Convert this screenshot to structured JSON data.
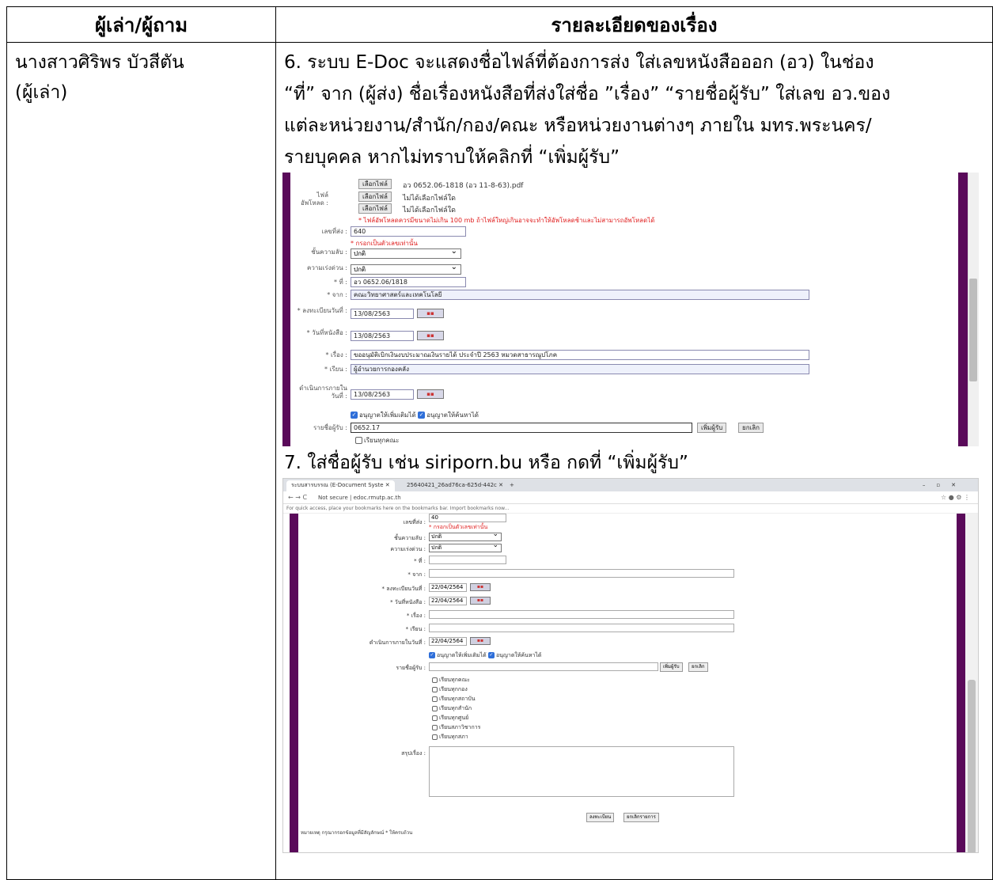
{
  "table": {
    "header_col1": "ผู้เล่า/ผู้ถาม",
    "header_col2": "รายละเอียดของเรื่อง",
    "narrator_name": "นางสาวศิริพร  บัวสีตัน",
    "narrator_role": "(ผู้เล่า)",
    "step6_lines": [
      "6. ระบบ E-Doc จะแสดงชื่อไฟล์ที่ต้องการส่ง ใส่เลขหนังสือออก (อว) ในช่อง",
      "“ที่” จาก (ผู้ส่ง) ชื่อเรื่องหนังสือที่ส่งใส่ชื่อ ”เรื่อง” “รายชื่อผู้รับ” ใส่เลข อว.ของ",
      "แต่ละหน่วยงาน/สำนัก/กอง/คณะ หรือหน่วยงานต่างๆ ภายใน มทร.พระนคร/",
      "รายบุคคล หากไม่ทราบให้คลิกที่ “เพิ่มผู้รับ”"
    ],
    "step7_line": "7. ใส่ชื่อผู้รับ เช่น siriporn.bu หรือ กดที่ “เพิ่มผู้รับ”"
  },
  "ss1": {
    "choose_file": "เลือกไฟล์",
    "file1": "อว 0652.06-1818 (อว 11-8-63).pdf",
    "no_file": "ไม่ได้เลือกไฟล์ใด",
    "upload_label": "ไฟล์อัพโหลด :",
    "upload_note": "* ไฟล์อัพโหลดควรมีขนาดไม่เกิน 100 mb ถ้าไฟล์ใหญ่เกินอาจจะทำให้อัพโหลดช้าและไม่สามารถอัพโหลดได้",
    "send_no_label": "เลขที่ส่ง :",
    "send_no": "640",
    "send_no_note": "* กรอกเป็นตัวเลขเท่านั้น",
    "secrecy_label": "ชั้นความลับ :",
    "secrecy": "ปกติ",
    "urgency_label": "ความเร่งด่วน :",
    "urgency": "ปกติ",
    "ref_label": "* ที่ :",
    "ref": "อว 0652.06/1818",
    "from_label": "* จาก :",
    "from": "คณะวิทยาศาสตร์และเทคโนโลยี",
    "reg_date_label": "* ลงทะเบียนวันที่ :",
    "reg_date": "13/08/2563",
    "doc_date_label": "* วันที่หนังสือ :",
    "doc_date": "13/08/2563",
    "subject_label": "* เรื่อง :",
    "subject": "ขออนุมัติเบิกเงินงบประมาณเงินรายได้ ประจำปี 2563 หมวดสาธารณูปโภค",
    "to_label": "* เรียน :",
    "to": "ผู้อำนวยการกองคลัง",
    "proc_date_label": "ดำเนินการภายในวันที่ :",
    "proc_date": "13/08/2563",
    "allow_add": "อนุญาตให้เพิ่มเติมได้",
    "allow_search": "อนุญาตให้ค้นหาได้",
    "recipients_label": "รายชื่อผู้รับ :",
    "recipients": "0652.17",
    "add_btn": "เพิ่มผู้รับ",
    "cancel_btn": "ยกเลิก",
    "all_faculty": "เรียนทุกคณะ",
    "cal": "▪▪"
  },
  "ss2": {
    "tab1": "ระบบสารบรรณ (E-Document Syste",
    "tab2": "25640421_26ad76ca-625d-442c",
    "url": "Not secure | edoc.rmutp.ac.th",
    "bookmarks": "For quick access, place your bookmarks here on the bookmarks bar. Import bookmarks now...",
    "send_no_label": "เลขที่ส่ง :",
    "send_no": "40",
    "send_note": "* กรอกเป็นตัวเลขเท่านั้น",
    "secrecy_label": "ชั้นความลับ :",
    "secrecy": "ปกติ",
    "urgency_label": "ความเร่งด่วน :",
    "urgency": "ปกติ",
    "ref_label": "* ที่ :",
    "from_label": "* จาก :",
    "reg_date_label": "* ลงทะเบียนวันที่ :",
    "reg_date": "22/04/2564",
    "doc_date_label": "* วันที่หนังสือ :",
    "doc_date": "22/04/2564",
    "subject_label": "* เรื่อง :",
    "to_label": "* เรียน :",
    "proc_date_label": "ดำเนินการภายในวันที่ :",
    "proc_date": "22/04/2564",
    "allow_add": "อนุญาตให้เพิ่มเติมได้",
    "allow_search": "อนุญาตให้ค้นหาได้",
    "recipients_label": "รายชื่อผู้รับ :",
    "add_btn": "เพิ่มผู้รับ",
    "cancel_btn": "ยกเลิก",
    "groups": [
      "เรียนทุกคณะ",
      "เรียนทุกกอง",
      "เรียนทุกสถาบัน",
      "เรียนทุกสำนัก",
      "เรียนทุกศูนย์",
      "เรียนสภาวิชาการ",
      "เรียนทุกสภา"
    ],
    "summary_label": "สรุปเรื่อง :",
    "save_btn": "ลงทะเบียน",
    "cancel_list_btn": "ยกเลิกรายการ",
    "footnote": "หมายเหตุ กรุณากรอกข้อมูลที่มีสัญลักษณ์ * ให้ครบถ้วน",
    "cal": "▪▪"
  }
}
